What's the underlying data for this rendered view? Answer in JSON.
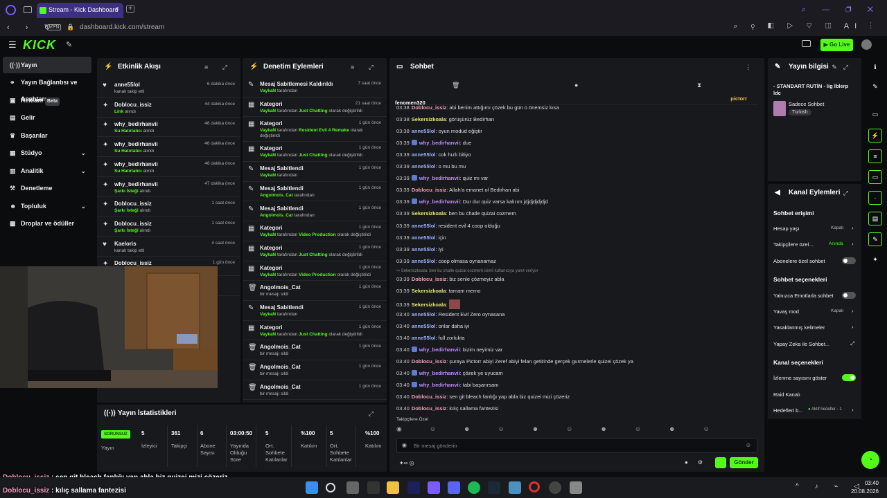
{
  "browser": {
    "tab_title": "Stream - Kick Dashboard",
    "url": "dashboard.kick.com/stream",
    "vpn": "VPN",
    "ai_label": "AI"
  },
  "header": {
    "logo": "KICK",
    "go_live": "Go Live"
  },
  "sidebar": {
    "items": [
      {
        "label": "Yayın"
      },
      {
        "label": "Yayın Bağlantısı ve Anahtarı"
      },
      {
        "label": "Reklam",
        "badge": "Beta"
      },
      {
        "label": "Gelir"
      },
      {
        "label": "Başarılar"
      },
      {
        "label": "Stüdyo"
      },
      {
        "label": "Analitik"
      },
      {
        "label": "Denetleme"
      },
      {
        "label": "Topluluk"
      },
      {
        "label": "Droplar ve ödüller"
      }
    ]
  },
  "activity": {
    "title": "Etkinlik Akışı",
    "rows": [
      {
        "name": "anne55lol",
        "sub": "kanalı takip etti",
        "time": "6 dakika önce"
      },
      {
        "name": "Doblocu_issiz",
        "sub_g": "Link",
        "sub": " alındı",
        "time": "44 dakika önce"
      },
      {
        "name": "why_bedirhanvii",
        "sub_g": "Su Hatırlatıcı",
        "sub": " alındı",
        "time": "46 dakika önce"
      },
      {
        "name": "why_bedirhanvii",
        "sub_g": "Su Hatırlatıcı",
        "sub": " alındı",
        "time": "46 dakika önce"
      },
      {
        "name": "why_bedirhanvii",
        "sub_g": "Su Hatırlatıcı",
        "sub": " alındı",
        "time": "46 dakika önce"
      },
      {
        "name": "why_bedirhanvii",
        "sub_g": "Şarkı İsteği",
        "sub": " alındı",
        "time": "47 dakika önce"
      },
      {
        "name": "Doblocu_issiz",
        "sub_g": "Şarkı İsteği",
        "sub": " alındı",
        "time": "1 saat önce"
      },
      {
        "name": "Doblocu_issiz",
        "sub_g": "Şarkı İsteği",
        "sub": " alındı",
        "time": "1 saat önce"
      },
      {
        "name": "Kaeloris",
        "sub": "kanalı takip etti",
        "time": "4 saat önce"
      },
      {
        "name": "Doblocu_issiz",
        "sub": "",
        "time": "1 gün önce"
      }
    ],
    "last_sub": "Su Hatırlatıcı",
    "last_sub2": " alındı"
  },
  "moderation": {
    "title": "Denetim Eylemleri",
    "rows": [
      {
        "name": "Mesaj Sabitlemesi Kaldırıldı",
        "g": "VaykaN",
        "s": " tarafından",
        "time": "7 saat önce"
      },
      {
        "name": "Kategori",
        "g": "VaykaN",
        "s": " tarafından ",
        "g2": "Just Chatting",
        "s2": " olarak değiştirildi",
        "time": "21 saat önce"
      },
      {
        "name": "Kategori",
        "g": "VaykaN",
        "s": " tarafından ",
        "g2": "Resident Evil 4 Remake",
        "s2": " olarak",
        "time": "1 gün önce"
      },
      {
        "name": "Kategori",
        "g": "VaykaN",
        "s": " tarafından ",
        "g2": "Just Chatting",
        "s2": " olarak değiştirildi",
        "time": "1 gün önce"
      },
      {
        "name": "Mesaj Sabitlendi",
        "g": "VaykaN",
        "s": " tarafından",
        "time": "1 gün önce"
      },
      {
        "name": "Mesaj Sabitlendi",
        "g": "Angolmois_Cat",
        "s": " tarafından",
        "time": "1 gün önce"
      },
      {
        "name": "Mesaj Sabitlendi",
        "g": "Angolmois_Cat",
        "s": " tarafından",
        "time": "1 gün önce"
      },
      {
        "name": "Kategori",
        "g": "VaykaN",
        "s": " tarafından ",
        "g2": "Video Production",
        "s2": " olarak değiştirildi",
        "time": "1 gün önce"
      },
      {
        "name": "Kategori",
        "g": "VaykaN",
        "s": " tarafından ",
        "g2": "Just Chatting",
        "s2": " olarak değiştirildi",
        "time": "1 gün önce"
      },
      {
        "name": "Kategori",
        "g": "VaykaN",
        "s": " tarafından ",
        "g2": "Video Production",
        "s2": " olarak değiştirildi",
        "time": "1 gün önce"
      },
      {
        "name": "Angolmois_Cat",
        "s": "bir mesajı sildi",
        "time": "1 gün önce"
      },
      {
        "name": "Mesaj Sabitlendi",
        "g": "VaykaN",
        "s": " tarafından",
        "time": "1 gün önce"
      },
      {
        "name": "Kategori",
        "g": "VaykaN",
        "s": " tarafından ",
        "g2": "Just Chatting",
        "s2": " olarak değiştirildi",
        "time": "1 gün önce"
      },
      {
        "name": "Angolmois_Cat",
        "s": "bir mesajı sildi",
        "time": "1 gün önce"
      },
      {
        "name": "Angolmois_Cat",
        "s": "bir mesajı sildi",
        "time": "1 gün önce"
      },
      {
        "name": "Angolmois_Cat",
        "s": "bir mesajı sildi",
        "time": "1 gün önce"
      }
    ],
    "wrap_extra": "değiştirildi"
  },
  "chat": {
    "title": "Sohbet",
    "pinned_user": "fenomen320",
    "pinned_badge": "pictorr",
    "messages": [
      {
        "t": "03:38",
        "u": "Doblocu_issiz",
        "c": "#f4a0b8",
        "m": "abi benim attığımı çözek bu gün o önemsiz kısa"
      },
      {
        "t": "03:38",
        "u": "Sekersizkoala",
        "c": "#e8e87a",
        "m": "görüşürüz Bedirhan"
      },
      {
        "t": "03:38",
        "u": "anne55lol",
        "c": "#9ab0ff",
        "m": "oyun modud eğiştir"
      },
      {
        "t": "03:39",
        "u": "why_bedirhanvii",
        "c": "#c08cff",
        "m": "due",
        "b": true
      },
      {
        "t": "03:39",
        "u": "anne55lol",
        "c": "#9ab0ff",
        "m": "cok hızlı bitiyo"
      },
      {
        "t": "03:39",
        "u": "anne55lol",
        "c": "#9ab0ff",
        "m": "o mu bu mu"
      },
      {
        "t": "03:39",
        "u": "why_bedirhanvii",
        "c": "#c08cff",
        "m": "quiz mı var",
        "b": true
      },
      {
        "t": "03:39",
        "u": "Doblocu_issiz",
        "c": "#f4a0b8",
        "m": "Allah'a emanet ol Bedirhan abi"
      },
      {
        "t": "03:39",
        "u": "why_bedirhanvii",
        "c": "#c08cff",
        "m": "Dur dur quiz varsa kalırım jdjdjdjdjdjd",
        "b": true
      },
      {
        "t": "03:39",
        "u": "Sekersizkoala",
        "c": "#e8e87a",
        "m": "ben bu chatle quizai cozmem"
      },
      {
        "t": "03:39",
        "u": "anne55lol",
        "c": "#9ab0ff",
        "m": "resident evil 4 coop olduğu"
      },
      {
        "t": "03:39",
        "u": "anne55lol",
        "c": "#9ab0ff",
        "m": "için"
      },
      {
        "t": "03:39",
        "u": "anne55lol",
        "c": "#9ab0ff",
        "m": "iyi"
      },
      {
        "t": "03:39",
        "u": "anne55lol",
        "c": "#9ab0ff",
        "m": "coop olmasa oynanamaz"
      },
      {
        "reply": "Sekersizkoala: ben bu chatle quizai cozmem isimli kullanıcıya yanıt veriyor"
      },
      {
        "t": "03:39",
        "u": "Doblocu_issiz",
        "c": "#f4a0b8",
        "m": "biz senle çözmeyiz abla"
      },
      {
        "t": "03:39",
        "u": "Sekersizkoala",
        "c": "#e8e87a",
        "m": "tamam memo"
      },
      {
        "t": "03:39",
        "u": "Sekersizkoala",
        "c": "#e8e87a",
        "m": "",
        "emote": true
      },
      {
        "t": "03:40",
        "u": "anne55lol",
        "c": "#9ab0ff",
        "m": "Resident Evil Zero oynasana"
      },
      {
        "t": "03:40",
        "u": "anne55lol",
        "c": "#9ab0ff",
        "m": "onlar daha iyi"
      },
      {
        "t": "03:40",
        "u": "anne55lol",
        "c": "#9ab0ff",
        "m": "full zorlukta"
      },
      {
        "t": "03:40",
        "u": "why_bedirhanvii",
        "c": "#c08cff",
        "m": "bizim neyimiz var",
        "b": true
      },
      {
        "t": "03:40",
        "u": "Doblocu_issiz",
        "c": "#f4a0b8",
        "m": "şuraya Pictorr abiyi Zeref abiyi felan getirinde gerçek gurmelerle quizei çözek ya"
      },
      {
        "t": "03:40",
        "u": "why_bedirhanvii",
        "c": "#c08cff",
        "m": "çözek ye uyucam",
        "b": true
      },
      {
        "t": "03:40",
        "u": "why_bedirhanvii",
        "c": "#c08cff",
        "m": "tabi başarırsam",
        "b": true
      },
      {
        "t": "03:40",
        "u": "Doblocu_issiz",
        "c": "#f4a0b8",
        "m": "sen git bleach fanlığı yap abla biz quizei mizi çözeriz"
      },
      {
        "t": "03:40",
        "u": "Doblocu_issiz",
        "c": "#f4a0b8",
        "m": "kılıç sallama fantezisi"
      }
    ],
    "followers_only": "Takipçilere Özel",
    "placeholder": "Bir mesaj gönderin",
    "send": "Gönder"
  },
  "stream_info": {
    "title": "Yayın bilgisi",
    "stream_title": "- STANDART RUTİN - lig lblerp ldc",
    "category": "Sadece Sohbet",
    "tag": "Turkish"
  },
  "channel_actions": {
    "title": "Kanal Eylemleri",
    "sec1": "Sohbet erişimi",
    "account_age": "Hesap yaşı",
    "account_age_v": "Kapalı",
    "followers_only": "Takipçilere özel...",
    "followers_only_v": "Anında",
    "subs_only": "Abonelere özel sohbet",
    "sec2": "Sohbet seçenekleri",
    "emotes_only": "Yalnızca Emotlarla sohbet",
    "slow_mode": "Yavaş mod",
    "slow_mode_v": "Kapalı",
    "banned_words": "Yasaklanmış kelimeler",
    "ai_chat": "Yapay Zeka ile Sohbet...",
    "sec3": "Kanal seçenekleri",
    "show_viewers": "İzlenme sayısını göster",
    "raid": "Raid Kanalı",
    "goals": "Hedefleri b...",
    "goals_v": "Aktif hedefler - 1"
  },
  "stats": {
    "title": "Yayın İstatistikleri",
    "status": "SORUNSUZ",
    "status_label": "Yayın",
    "cells": [
      {
        "v": "5",
        "l": "İzleyici"
      },
      {
        "v": "361",
        "l": "Takipçi"
      },
      {
        "v": "6",
        "l": "Abone Sayısı"
      },
      {
        "v": "03:00:50",
        "l": "Yayında Olduğu Süre"
      },
      {
        "v": "5",
        "l": "Ort. Sohbete Katılanlar"
      },
      {
        "v": "%100",
        "l": "Katılım"
      },
      {
        "v": "5",
        "l": "Ort. Sohbete Katılanlar"
      },
      {
        "v": "%100",
        "l": "Katılım"
      }
    ]
  },
  "subtitles": [
    {
      "u": "Doblocu_issiz",
      "m": " : sen git bleach fanlığı yap abla biz quizei mizi çözeriz"
    },
    {
      "u": "Doblocu_issiz",
      "m": " : kılıç sallama fantezisi"
    }
  ],
  "taskbar": {
    "time": "03:40",
    "date": "20.08.2026"
  }
}
